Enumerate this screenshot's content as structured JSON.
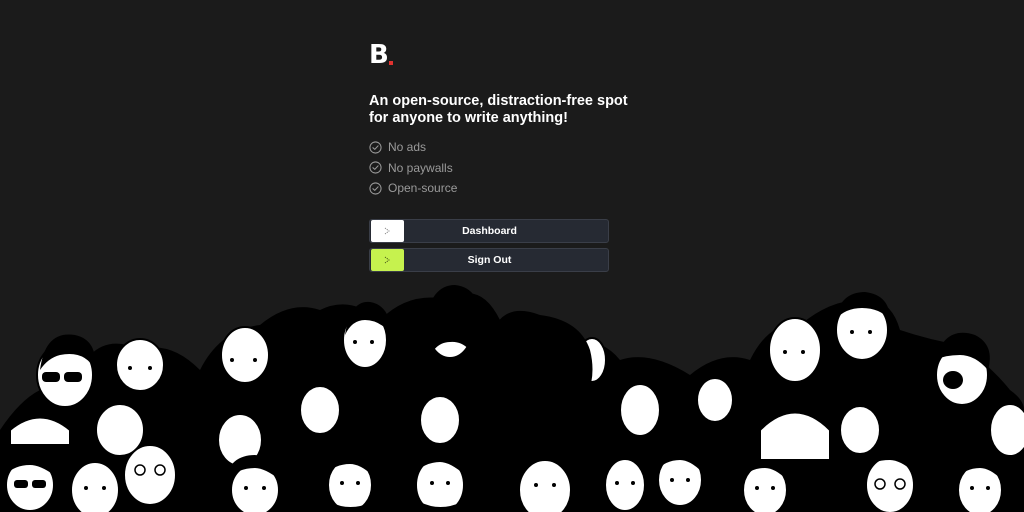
{
  "logo": {
    "letter": "B",
    "accent_color": "#e0322f"
  },
  "headline": "An open-source, distraction-free spot for anyone to write anything!",
  "features": [
    {
      "label": "No ads",
      "icon": "check-circle-icon"
    },
    {
      "label": "No paywalls",
      "icon": "check-circle-icon"
    },
    {
      "label": "Open-source",
      "icon": "check-circle-icon"
    }
  ],
  "buttons": {
    "dashboard": {
      "label": "Dashboard",
      "icon": "arrow-right-icon",
      "icon_bg": "#ffffff"
    },
    "signout": {
      "label": "Sign Out",
      "icon": "arrow-right-icon",
      "icon_bg": "#c6f24e"
    }
  },
  "colors": {
    "background": "#1b1b1b",
    "button_bg": "#262a33"
  },
  "illustration": {
    "name": "crowd-of-people-illustration"
  }
}
